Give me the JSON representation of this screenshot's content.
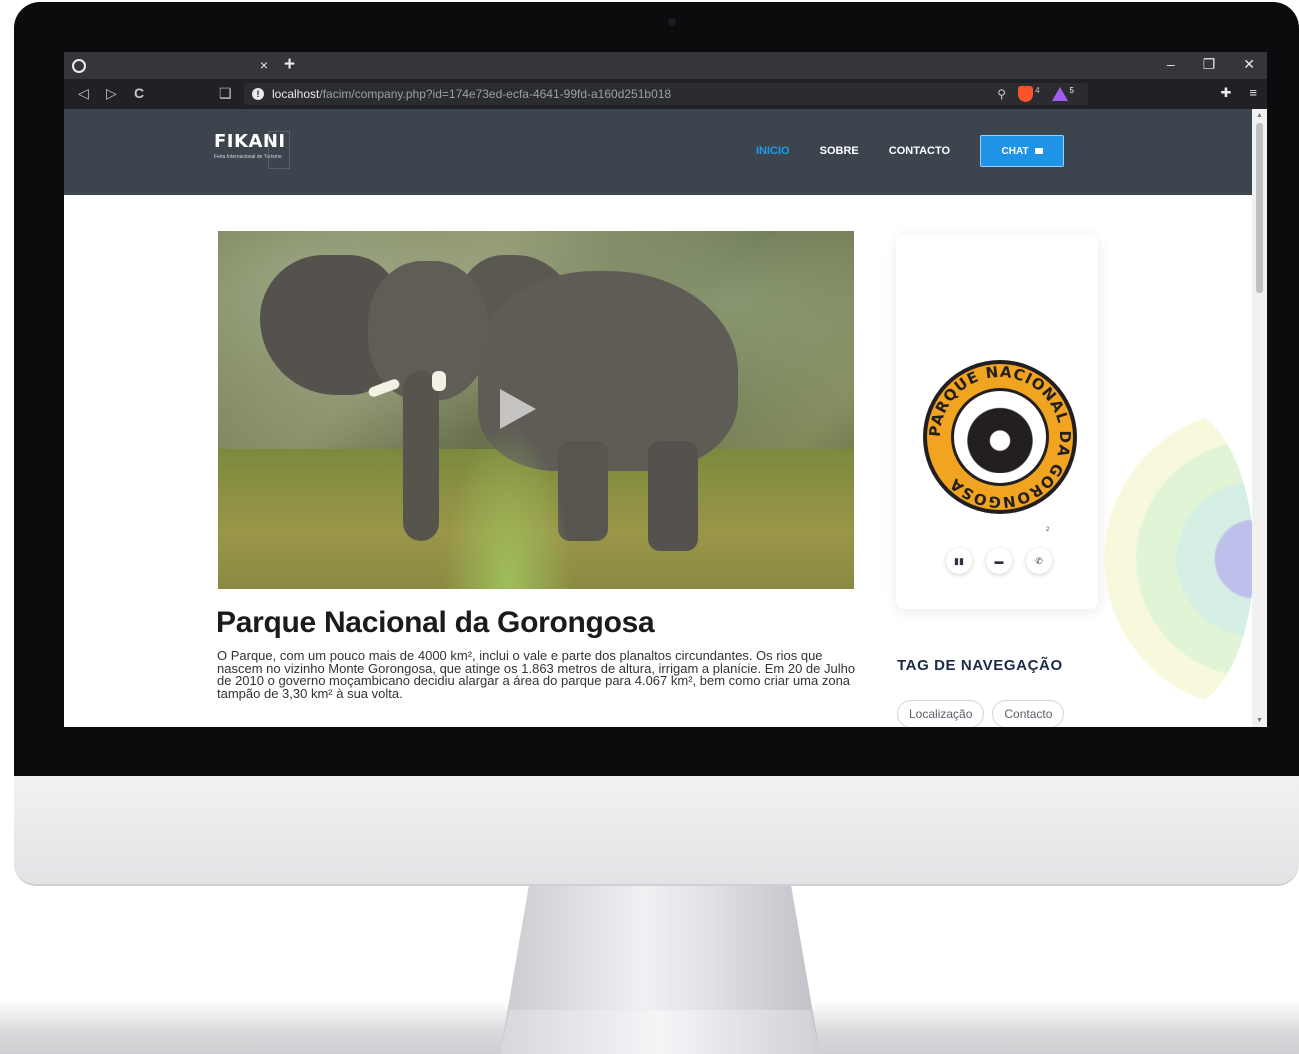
{
  "browser": {
    "tab_close": "×",
    "new_tab": "+",
    "win_minimize": "–",
    "win_restore": "❐",
    "win_close": "✕",
    "back": "◁",
    "forward": "▷",
    "reload": "C",
    "bookmark": "❑",
    "url_host": "localhost",
    "url_path": "/facim/company.php?id=174e73ed-ecfa-4641-99fd-a160d251b018",
    "zoom_icon": "⚲",
    "brave_shield_count": "4",
    "rewards_count": "5",
    "extensions": "✚",
    "menu": "≡"
  },
  "header": {
    "logo_name": "FIKANI",
    "logo_subtitle": "Feira Internacional de Turismo",
    "nav": [
      {
        "label": "INICIO"
      },
      {
        "label": "SOBRE"
      },
      {
        "label": "CONTACTO"
      }
    ],
    "chat_label": "CHAT",
    "colors": {
      "header_bg": "#3c454d",
      "active": "#1f9bf0",
      "chat_bg": "#1f93e6"
    }
  },
  "main": {
    "title": "Parque Nacional da Gorongosa",
    "description": "O Parque, com um pouco mais de 4000 km², inclui o vale e parte dos planaltos circundantes. Os rios que nascem no vizinho Monte Gorongosa, que atinge os 1.863 metros de altura, irrigam a planície. Em 20 de Julho de 2010 o governo moçambicano decidiu alargar a área do parque para 4.067 km², bem como criar uma zona tampão de 3,30 km² à sua volta."
  },
  "sidebar": {
    "badge_text": "PARQUE NACIONAL DA GORONGOSA",
    "tiny_text": "2",
    "tag_title": "TAG DE NAVEGAÇÃO",
    "tags": [
      "Localização",
      "Contacto"
    ]
  }
}
